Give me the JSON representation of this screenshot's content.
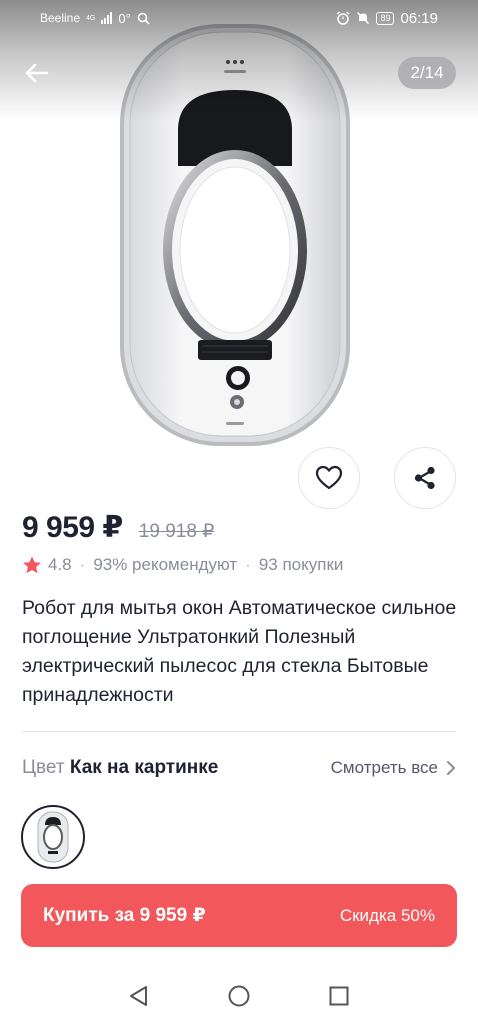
{
  "status_bar": {
    "carrier": "Beeline",
    "network": "4G",
    "temperature": "0°",
    "battery": "89",
    "time": "06:19"
  },
  "gallery": {
    "counter": "2/14",
    "current_index": 2,
    "total": 14
  },
  "icons": {
    "back": "back-arrow-icon",
    "favorite": "heart-icon",
    "share": "share-icon",
    "rating": "star-icon",
    "chevron": "chevron-right-icon"
  },
  "product": {
    "price": "9 959 ₽",
    "old_price": "19 918 ₽",
    "rating": "4.8",
    "recommend": "93% рекомендуют",
    "purchases": "93 покупки",
    "title": "Робот для мытья окон Автоматическое сильное поглощение Ультратонкий Полезный электрический пылесос для стекла Бытовые принадлежности"
  },
  "color_selector": {
    "label": "Цвет",
    "value": "Как на картинке",
    "see_all": "Смотреть все"
  },
  "buy_button": {
    "label": "Купить за 9 959 ₽",
    "discount": "Скидка 50%"
  },
  "colors": {
    "accent": "#f2585b",
    "rating_star": "#f2585b",
    "text_primary": "#1f2230",
    "text_secondary": "#8a8d99"
  }
}
